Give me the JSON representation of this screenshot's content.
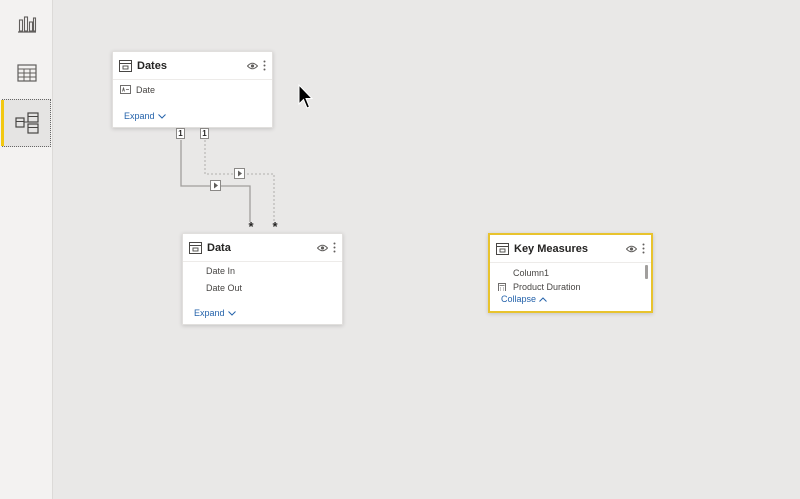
{
  "colors": {
    "accent": "#f2c811",
    "link": "#2563ab",
    "selected_border": "#e8c32e",
    "canvas": "#e9e8e7"
  },
  "rail": {
    "items": [
      {
        "name": "report-view",
        "icon": "bar-chart-icon"
      },
      {
        "name": "data-view",
        "icon": "table-grid-icon"
      },
      {
        "name": "model-view",
        "icon": "model-diagram-icon",
        "active": true
      }
    ]
  },
  "tables": {
    "dates": {
      "title": "Dates",
      "fields": [
        "Date"
      ],
      "footer": "Expand",
      "field_icon": "calendar-text-icon"
    },
    "data": {
      "title": "Data",
      "fields": [
        "Date In",
        "Date Out"
      ],
      "footer": "Expand"
    },
    "key_measures": {
      "title": "Key Measures",
      "fields": [
        "Column1",
        "Product Duration"
      ],
      "footer": "Collapse",
      "selected": true
    }
  },
  "relationships": {
    "one_label": "1",
    "many_label": "*"
  }
}
